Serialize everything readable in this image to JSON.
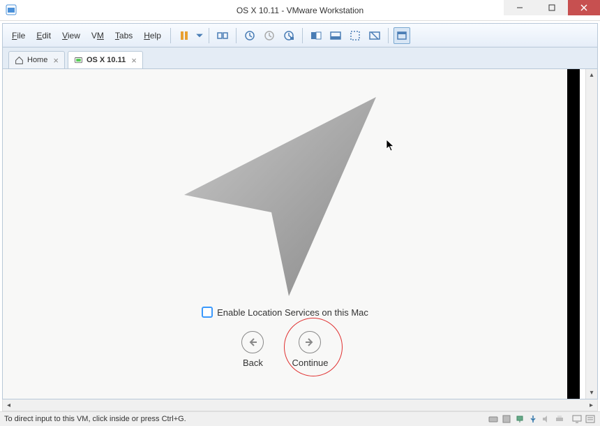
{
  "window": {
    "title": "OS X 10.11 - VMware Workstation"
  },
  "menu": {
    "file": "File",
    "edit": "Edit",
    "view": "View",
    "vm": "VM",
    "tabs": "Tabs",
    "help": "Help"
  },
  "tabs": {
    "home": "Home",
    "vm": "OS X 10.11"
  },
  "setup": {
    "checkbox_label": "Enable Location Services on this Mac",
    "back": "Back",
    "continue": "Continue"
  },
  "status": {
    "message": "To direct input to this VM, click inside or press Ctrl+G."
  }
}
